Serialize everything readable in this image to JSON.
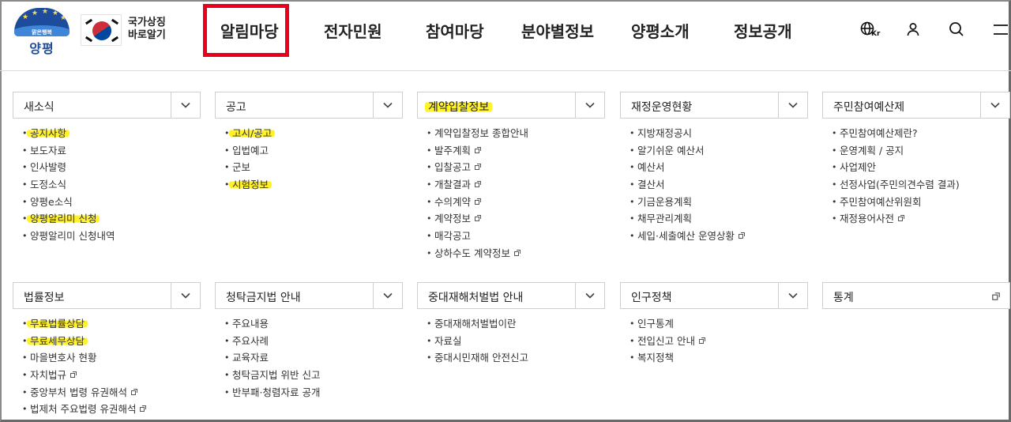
{
  "header": {
    "logo": {
      "slogan": "맑은행복",
      "name": "양평"
    },
    "symbol": {
      "line1": "국가상징",
      "line2": "바로알기"
    },
    "menu": [
      "알림마당",
      "전자민원",
      "참여마당",
      "분야별정보",
      "양평소개",
      "정보공개"
    ],
    "utils": {
      "language_badge": "Kr",
      "icons": [
        "globe-icon",
        "user-icon",
        "search-icon",
        "menu-icon"
      ]
    }
  },
  "panels": [
    {
      "title": "새소식",
      "items": [
        {
          "label": "공지사항",
          "highlight": true
        },
        {
          "label": "보도자료"
        },
        {
          "label": "인사발령"
        },
        {
          "label": "도정소식"
        },
        {
          "label": "양평e소식"
        },
        {
          "label": "양평알리미 신청",
          "highlight": true
        },
        {
          "label": "양평알리미 신청내역"
        }
      ]
    },
    {
      "title": "공고",
      "items": [
        {
          "label": "고시/공고",
          "highlight": true
        },
        {
          "label": "입법예고"
        },
        {
          "label": "군보"
        },
        {
          "label": "시험정보",
          "highlight": true
        }
      ]
    },
    {
      "title": "계약입찰정보",
      "title_highlight": true,
      "items": [
        {
          "label": "계약입찰정보 종합안내"
        },
        {
          "label": "발주계획",
          "external": true
        },
        {
          "label": "입찰공고",
          "external": true
        },
        {
          "label": "개찰결과",
          "external": true
        },
        {
          "label": "수의계약",
          "external": true
        },
        {
          "label": "계약정보",
          "external": true
        },
        {
          "label": "매각공고"
        },
        {
          "label": "상하수도 계약정보",
          "external": true
        }
      ]
    },
    {
      "title": "재정운영현황",
      "items": [
        {
          "label": "지방재정공시"
        },
        {
          "label": "알기쉬운 예산서"
        },
        {
          "label": "예산서"
        },
        {
          "label": "결산서"
        },
        {
          "label": "기금운용계획"
        },
        {
          "label": "채무관리계획"
        },
        {
          "label": "세입·세출예산 운영상황",
          "external": true
        }
      ]
    },
    {
      "title": "주민참여예산제",
      "items": [
        {
          "label": "주민참여예산제란?"
        },
        {
          "label": "운영계획 / 공지"
        },
        {
          "label": "사업제안"
        },
        {
          "label": "선정사업(주민의견수렴 결과)"
        },
        {
          "label": "주민참여예산위원회"
        },
        {
          "label": "재정용어사전",
          "external": true
        }
      ]
    },
    {
      "title": "법률정보",
      "items": [
        {
          "label": "무료법률상담",
          "highlight": true
        },
        {
          "label": "무료세무상담",
          "highlight": true
        },
        {
          "label": "마을변호사 현황"
        },
        {
          "label": "자치법규",
          "external": true
        },
        {
          "label": "중앙부처 법령 유권해석",
          "external": true
        },
        {
          "label": "법제처 주요법령 유권해석",
          "external": true
        }
      ]
    },
    {
      "title": "청탁금지법 안내",
      "items": [
        {
          "label": "주요내용"
        },
        {
          "label": "주요사례"
        },
        {
          "label": "교육자료"
        },
        {
          "label": "청탁금지법 위반 신고"
        },
        {
          "label": "반부패·청렴자료 공개"
        }
      ]
    },
    {
      "title": "중대재해처벌법 안내",
      "items": [
        {
          "label": "중대재해처벌법이란"
        },
        {
          "label": "자료실"
        },
        {
          "label": "중대시민재해 안전신고"
        }
      ]
    },
    {
      "title": "인구정책",
      "items": [
        {
          "label": "인구통계"
        },
        {
          "label": "전입신고 안내",
          "external": true
        },
        {
          "label": "복지정책"
        }
      ]
    },
    {
      "title": "통계",
      "external_header": true,
      "items": []
    }
  ],
  "colors": {
    "highlight": "#fff12a",
    "focus_box": "#e8001c",
    "brand": "#1d4c9c"
  }
}
